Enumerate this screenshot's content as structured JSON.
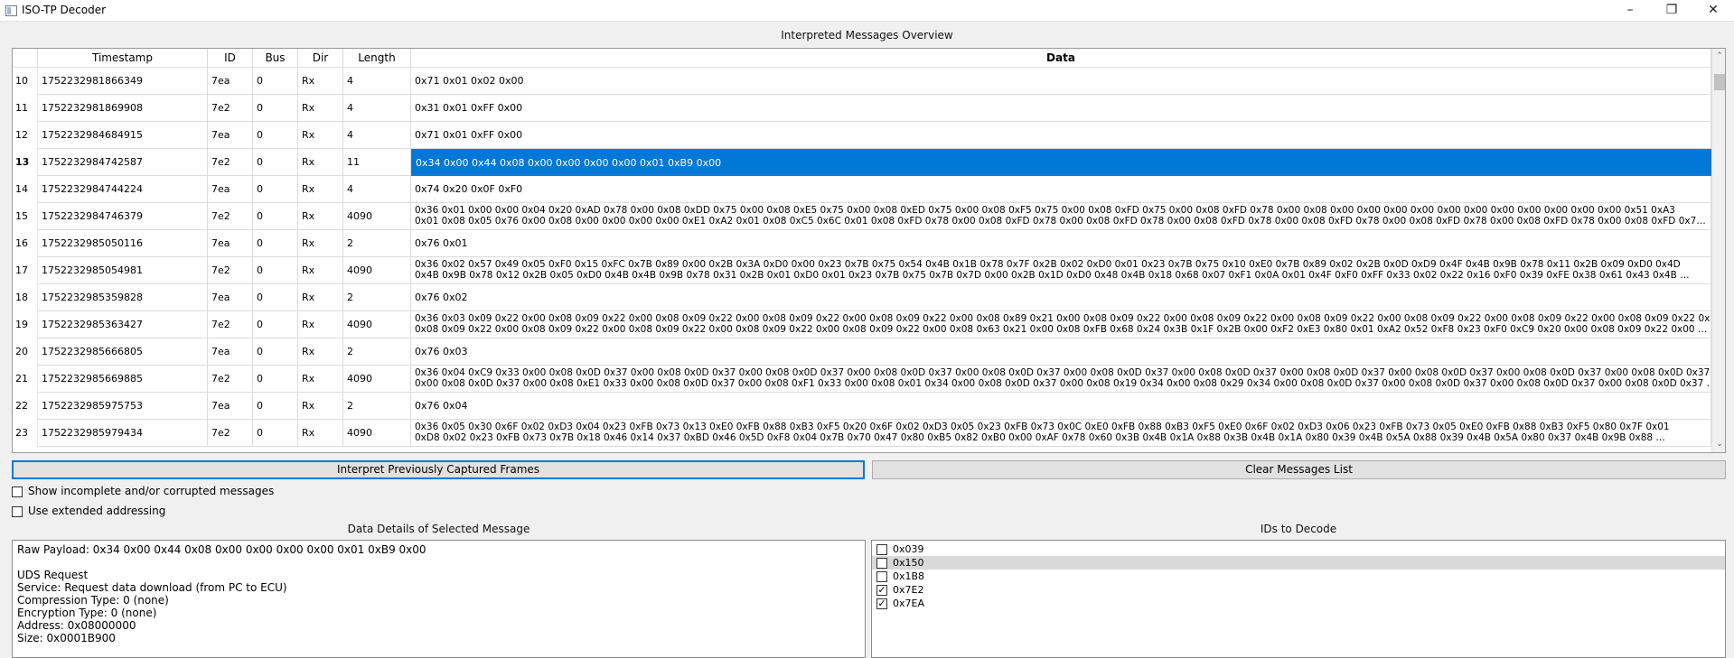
{
  "window": {
    "title": "ISO-TP Decoder",
    "minimize": "–",
    "maximize": "❐",
    "close": "✕"
  },
  "overview_label": "Interpreted Messages Overview",
  "columns": [
    "Timestamp",
    "ID",
    "Bus",
    "Dir",
    "Length",
    "Data"
  ],
  "rows": [
    {
      "num": "10",
      "timestamp": "1752232981866349",
      "id": "7ea",
      "bus": "0",
      "dir": "Rx",
      "length": "4",
      "data": [
        "0x71 0x01 0x02 0x00"
      ]
    },
    {
      "num": "11",
      "timestamp": "1752232981869908",
      "id": "7e2",
      "bus": "0",
      "dir": "Rx",
      "length": "4",
      "data": [
        "0x31 0x01 0xFF 0x00"
      ]
    },
    {
      "num": "12",
      "timestamp": "1752232984684915",
      "id": "7ea",
      "bus": "0",
      "dir": "Rx",
      "length": "4",
      "data": [
        "0x71 0x01 0xFF 0x00"
      ]
    },
    {
      "num": "13",
      "timestamp": "1752232984742587",
      "id": "7e2",
      "bus": "0",
      "dir": "Rx",
      "length": "11",
      "data": [
        "0x34 0x00 0x44 0x08 0x00 0x00 0x00 0x00 0x01 0xB9 0x00"
      ]
    },
    {
      "num": "14",
      "timestamp": "1752232984744224",
      "id": "7ea",
      "bus": "0",
      "dir": "Rx",
      "length": "4",
      "data": [
        "0x74 0x20 0x0F 0xF0"
      ]
    },
    {
      "num": "15",
      "timestamp": "1752232984746379",
      "id": "7e2",
      "bus": "0",
      "dir": "Rx",
      "length": "4090",
      "data": [
        "0x36 0x01 0x00 0x00 0x04 0x20 0xAD 0x78 0x00 0x08 0xDD 0x75 0x00 0x08 0xE5 0x75 0x00 0x08 0xED 0x75 0x00 0x08 0xF5 0x75 0x00 0x08 0xFD 0x75 0x00 0x08 0xFD 0x78 0x00 0x08 0x00 0x00 0x00 0x00 0x00 0x00 0x00 0x00 0x00 0x00 0x00 0x51 0xA3",
        "0x01 0x08 0x05 0x76 0x00 0x08 0x00 0x00 0x00 0x00 0xE1 0xA2 0x01 0x08 0xC5 0x6C 0x01 0x08 0xFD 0x78 0x00 0x08 0xFD 0x78 0x00 0x08 0xFD 0x78 0x00 0x08 0xFD 0x78 0x00 0x08 0xFD 0x78 0x00 0x08 0xFD 0x78 0x00 0x08 0xFD 0x78 0x00 0x08 0xFD 0x7…"
      ]
    },
    {
      "num": "16",
      "timestamp": "1752232985050116",
      "id": "7ea",
      "bus": "0",
      "dir": "Rx",
      "length": "2",
      "data": [
        "0x76 0x01"
      ]
    },
    {
      "num": "17",
      "timestamp": "1752232985054981",
      "id": "7e2",
      "bus": "0",
      "dir": "Rx",
      "length": "4090",
      "data": [
        "0x36 0x02 0x57 0x49 0x05 0xF0 0x15 0xFC 0x7B 0x89 0x00 0x2B 0x3A 0xD0 0x00 0x23 0x7B 0x75 0x54 0x4B 0x1B 0x78 0x7F 0x2B 0x02 0xD0 0x01 0x23 0x7B 0x75 0x10 0xE0 0x7B 0x89 0x02 0x2B 0x0D 0xD9 0x4F 0x4B 0x9B 0x78 0x11 0x2B 0x09 0xD0 0x4D",
        "0x4B 0x9B 0x78 0x12 0x2B 0x05 0xD0 0x4B 0x4B 0x9B 0x78 0x31 0x2B 0x01 0xD0 0x01 0x23 0x7B 0x75 0x7B 0x7D 0x00 0x2B 0x1D 0xD0 0x48 0x4B 0x18 0x68 0x07 0xF1 0x0A 0x01 0x4F 0xF0 0xFF 0x33 0x02 0x22 0x16 0xF0 0x39 0xFE 0x38 0x61 0x43 0x4B …"
      ]
    },
    {
      "num": "18",
      "timestamp": "1752232985359828",
      "id": "7ea",
      "bus": "0",
      "dir": "Rx",
      "length": "2",
      "data": [
        "0x76 0x02"
      ]
    },
    {
      "num": "19",
      "timestamp": "1752232985363427",
      "id": "7e2",
      "bus": "0",
      "dir": "Rx",
      "length": "4090",
      "data": [
        "0x36 0x03 0x09 0x22 0x00 0x08 0x09 0x22 0x00 0x08 0x09 0x22 0x00 0x08 0x09 0x22 0x00 0x08 0x09 0x22 0x00 0x08 0x89 0x21 0x00 0x08 0x09 0x22 0x00 0x08 0x09 0x22 0x00 0x08 0x09 0x22 0x00 0x08 0x09 0x22 0x00 0x08 0x09 0x22 0x00 0x08 0x09 0x22 0x00 0x08",
        "0x08 0x09 0x22 0x00 0x08 0x09 0x22 0x00 0x08 0x09 0x22 0x00 0x08 0x09 0x22 0x00 0x08 0x09 0x22 0x00 0x08 0x63 0x21 0x00 0x08 0xFB 0x68 0x24 0x3B 0x1F 0x2B 0x00 0xF2 0xE3 0x80 0x01 0xA2 0x52 0xF8 0x23 0xF0 0xC9 0x20 0x00 0x08 0x09 0x22 0x00 …"
      ]
    },
    {
      "num": "20",
      "timestamp": "1752232985666805",
      "id": "7ea",
      "bus": "0",
      "dir": "Rx",
      "length": "2",
      "data": [
        "0x76 0x03"
      ]
    },
    {
      "num": "21",
      "timestamp": "1752232985669885",
      "id": "7e2",
      "bus": "0",
      "dir": "Rx",
      "length": "4090",
      "data": [
        "0x36 0x04 0xC9 0x33 0x00 0x08 0x0D 0x37 0x00 0x08 0x0D 0x37 0x00 0x08 0x0D 0x37 0x00 0x08 0x0D 0x37 0x00 0x08 0x0D 0x37 0x00 0x08 0x0D 0x37 0x00 0x08 0x0D 0x37 0x00 0x08 0x0D 0x37 0x00 0x08 0x0D 0x37 0x00 0x08 0x0D 0x37 0x00 0x08 0x0D 0x37",
        "0x00 0x08 0x0D 0x37 0x00 0x08 0xE1 0x33 0x00 0x08 0x0D 0x37 0x00 0x08 0xF1 0x33 0x00 0x08 0x01 0x34 0x00 0x08 0x0D 0x37 0x00 0x08 0x19 0x34 0x00 0x08 0x29 0x34 0x00 0x08 0x0D 0x37 0x00 0x08 0x0D 0x37 0x00 0x08 0x0D 0x37 0x00 0x08 0x0D 0x37 …"
      ]
    },
    {
      "num": "22",
      "timestamp": "1752232985975753",
      "id": "7ea",
      "bus": "0",
      "dir": "Rx",
      "length": "2",
      "data": [
        "0x76 0x04"
      ]
    },
    {
      "num": "23",
      "timestamp": "1752232985979434",
      "id": "7e2",
      "bus": "0",
      "dir": "Rx",
      "length": "4090",
      "data": [
        "0x36 0x05 0x30 0x6F 0x02 0xD3 0x04 0x23 0xFB 0x73 0x13 0xE0 0xFB 0x88 0xB3 0xF5 0x20 0x6F 0x02 0xD3 0x05 0x23 0xFB 0x73 0x0C 0xE0 0xFB 0x88 0xB3 0xF5 0xE0 0x6F 0x02 0xD3 0x06 0x23 0xFB 0x73 0x05 0xE0 0xFB 0x88 0xB3 0xF5 0x80 0x7F 0x01",
        "0xD8 0x02 0x23 0xFB 0x73 0x7B 0x18 0x46 0x14 0x37 0xBD 0x46 0x5D 0xF8 0x04 0x7B 0x70 0x47 0x80 0xB5 0x82 0xB0 0x00 0xAF 0x78 0x60 0x3B 0x4B 0x1A 0x88 0x3B 0x4B 0x1A 0x80 0x39 0x4B 0x5A 0x88 0x39 0x4B 0x5A 0x80 0x37 0x4B 0x9B 0x88 …"
      ]
    }
  ],
  "selected_row": "13",
  "buttons": {
    "interpret": "Interpret Previously Captured Frames",
    "clear": "Clear Messages List"
  },
  "options": {
    "show_incomplete": "Show incomplete and/or corrupted messages",
    "extended_addressing": "Use extended addressing"
  },
  "details": {
    "label": "Data Details of Selected Message",
    "lines": [
      "Raw Payload: 0x34 0x00 0x44 0x08 0x00 0x00 0x00 0x00 0x01 0xB9 0x00",
      "",
      "UDS Request",
      "Service: Request data download (from PC to ECU)",
      "Compression Type: 0 (none)",
      "Encryption Type: 0 (none)",
      "Address: 0x08000000",
      "Size: 0x0001B900"
    ]
  },
  "ids_panel": {
    "label": "IDs to Decode",
    "items": [
      {
        "id": "0x039",
        "checked": false,
        "highlight": false
      },
      {
        "id": "0x150",
        "checked": false,
        "highlight": true
      },
      {
        "id": "0x1B8",
        "checked": false,
        "highlight": false
      },
      {
        "id": "0x7E2",
        "checked": true,
        "highlight": false
      },
      {
        "id": "0x7EA",
        "checked": true,
        "highlight": false
      }
    ]
  }
}
